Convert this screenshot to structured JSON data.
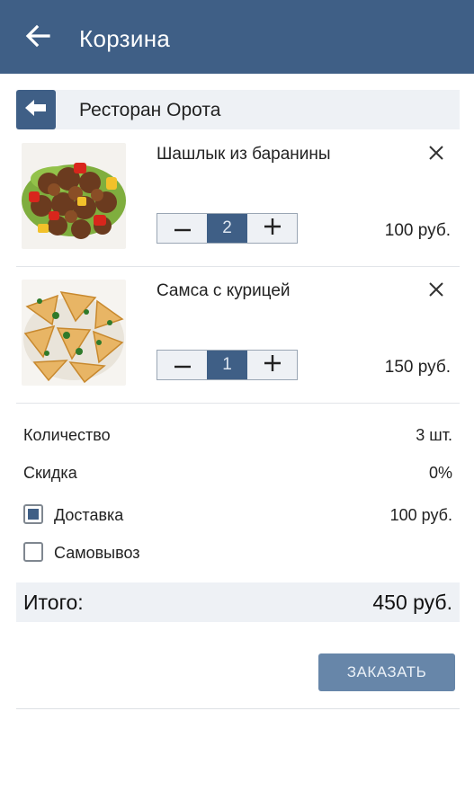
{
  "appbar": {
    "title": "Корзина",
    "back_icon": "arrow-left-icon"
  },
  "restaurant": {
    "name": "Ресторан Орота",
    "back_icon": "arrow-left-icon"
  },
  "items": [
    {
      "name": "Шашлык из баранины",
      "qty": "2",
      "price": "100 руб.",
      "image": "shashlik-photo"
    },
    {
      "name": "Самса с курицей",
      "qty": "1",
      "price": "150 руб.",
      "image": "samsa-photo"
    }
  ],
  "summary": {
    "quantity_label": "Количество",
    "quantity_value": "3 шт.",
    "discount_label": "Скидка",
    "discount_value": "0%",
    "delivery_label": "Доставка",
    "delivery_value": "100 руб.",
    "delivery_checked": true,
    "pickup_label": "Самовывоз",
    "pickup_checked": false
  },
  "total": {
    "label": "Итого:",
    "value": "450 руб."
  },
  "order_button": "ЗАКАЗАТЬ",
  "colors": {
    "primary": "#3f5f86",
    "button": "#6786a9",
    "panel": "#eef1f5"
  }
}
